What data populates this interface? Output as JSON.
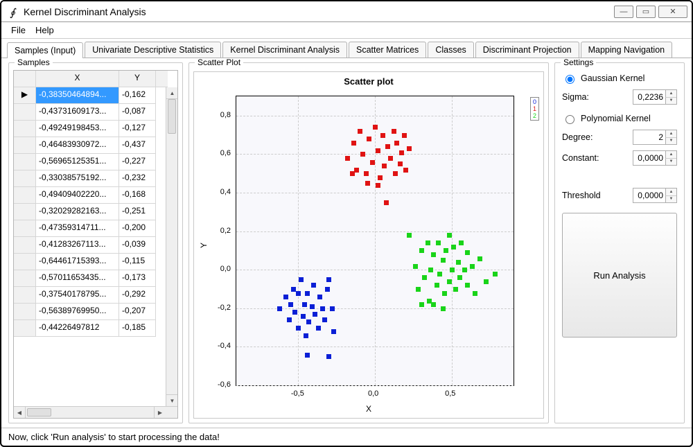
{
  "window": {
    "title": "Kernel Discriminant Analysis"
  },
  "menu": {
    "file": "File",
    "help": "Help"
  },
  "tabs": [
    "Samples (Input)",
    "Univariate Descriptive Statistics",
    "Kernel Discriminant Analysis",
    "Scatter Matrices",
    "Classes",
    "Discriminant Projection",
    "Mapping Navigation"
  ],
  "groups": {
    "samples": "Samples",
    "scatter": "Scatter Plot",
    "settings": "Settings"
  },
  "datagrid": {
    "columns": {
      "x": "X",
      "y": "Y"
    },
    "selector_glyph": "▶",
    "rows": [
      {
        "x": "-0,38350464894...",
        "y": "-0,162"
      },
      {
        "x": "-0,43731609173...",
        "y": "-0,087"
      },
      {
        "x": "-0,49249198453...",
        "y": "-0,127"
      },
      {
        "x": "-0,46483930972...",
        "y": "-0,437"
      },
      {
        "x": "-0,56965125351...",
        "y": "-0,227"
      },
      {
        "x": "-0,33038575192...",
        "y": "-0,232"
      },
      {
        "x": "-0,49409402220...",
        "y": "-0,168"
      },
      {
        "x": "-0,32029282163...",
        "y": "-0,251"
      },
      {
        "x": "-0,47359314711...",
        "y": "-0,200"
      },
      {
        "x": "-0,41283267113...",
        "y": "-0,039"
      },
      {
        "x": "-0,64461715393...",
        "y": "-0,115"
      },
      {
        "x": "-0,57011653435...",
        "y": "-0,173"
      },
      {
        "x": "-0,37540178795...",
        "y": "-0,292"
      },
      {
        "x": "-0,56389769950...",
        "y": "-0,207"
      },
      {
        "x": "-0,44226497812",
        "y": "-0,185"
      }
    ]
  },
  "chart_data": {
    "type": "scatter",
    "title": "Scatter plot",
    "xlabel": "X",
    "ylabel": "Y",
    "xlim": [
      -0.9,
      0.9
    ],
    "ylim": [
      -0.6,
      0.9
    ],
    "xticks": [
      -0.5,
      0.0,
      0.5
    ],
    "yticks": [
      -0.6,
      -0.4,
      -0.2,
      0.0,
      0.2,
      0.4,
      0.6,
      0.8
    ],
    "legend": [
      "0",
      "1",
      "2"
    ],
    "series": [
      {
        "name": "0",
        "color": "#0b1fd6",
        "points": [
          [
            -0.62,
            -0.2
          ],
          [
            -0.58,
            -0.14
          ],
          [
            -0.56,
            -0.26
          ],
          [
            -0.55,
            -0.18
          ],
          [
            -0.53,
            -0.1
          ],
          [
            -0.52,
            -0.22
          ],
          [
            -0.5,
            -0.3
          ],
          [
            -0.5,
            -0.12
          ],
          [
            -0.48,
            -0.05
          ],
          [
            -0.47,
            -0.24
          ],
          [
            -0.46,
            -0.18
          ],
          [
            -0.45,
            -0.34
          ],
          [
            -0.44,
            -0.12
          ],
          [
            -0.43,
            -0.27
          ],
          [
            -0.41,
            -0.19
          ],
          [
            -0.4,
            -0.08
          ],
          [
            -0.39,
            -0.23
          ],
          [
            -0.37,
            -0.3
          ],
          [
            -0.36,
            -0.14
          ],
          [
            -0.34,
            -0.2
          ],
          [
            -0.33,
            -0.26
          ],
          [
            -0.31,
            -0.1
          ],
          [
            -0.3,
            -0.45
          ],
          [
            -0.28,
            -0.2
          ],
          [
            -0.27,
            -0.32
          ],
          [
            -0.44,
            -0.44
          ],
          [
            -0.3,
            -0.05
          ]
        ]
      },
      {
        "name": "1",
        "color": "#e01313",
        "points": [
          [
            -0.18,
            0.58
          ],
          [
            -0.14,
            0.66
          ],
          [
            -0.12,
            0.52
          ],
          [
            -0.1,
            0.72
          ],
          [
            -0.08,
            0.6
          ],
          [
            -0.06,
            0.5
          ],
          [
            -0.04,
            0.68
          ],
          [
            -0.02,
            0.56
          ],
          [
            0.0,
            0.74
          ],
          [
            0.02,
            0.62
          ],
          [
            0.03,
            0.48
          ],
          [
            0.05,
            0.7
          ],
          [
            0.06,
            0.54
          ],
          [
            0.08,
            0.64
          ],
          [
            0.07,
            0.35
          ],
          [
            0.1,
            0.58
          ],
          [
            0.12,
            0.72
          ],
          [
            0.13,
            0.5
          ],
          [
            0.14,
            0.66
          ],
          [
            0.16,
            0.55
          ],
          [
            0.17,
            0.61
          ],
          [
            0.19,
            0.7
          ],
          [
            0.2,
            0.52
          ],
          [
            0.22,
            0.63
          ],
          [
            0.02,
            0.44
          ],
          [
            -0.05,
            0.45
          ],
          [
            -0.15,
            0.5
          ]
        ]
      },
      {
        "name": "2",
        "color": "#19d419",
        "points": [
          [
            0.22,
            0.18
          ],
          [
            0.26,
            0.02
          ],
          [
            0.28,
            -0.1
          ],
          [
            0.3,
            0.1
          ],
          [
            0.32,
            -0.04
          ],
          [
            0.34,
            0.14
          ],
          [
            0.35,
            -0.16
          ],
          [
            0.36,
            0.0
          ],
          [
            0.38,
            0.08
          ],
          [
            0.4,
            -0.08
          ],
          [
            0.41,
            0.14
          ],
          [
            0.42,
            -0.02
          ],
          [
            0.44,
            0.05
          ],
          [
            0.45,
            -0.12
          ],
          [
            0.46,
            0.1
          ],
          [
            0.48,
            -0.06
          ],
          [
            0.5,
            0.0
          ],
          [
            0.51,
            0.12
          ],
          [
            0.52,
            -0.1
          ],
          [
            0.54,
            0.04
          ],
          [
            0.55,
            -0.04
          ],
          [
            0.56,
            0.14
          ],
          [
            0.58,
            0.0
          ],
          [
            0.6,
            -0.08
          ],
          [
            0.6,
            0.09
          ],
          [
            0.63,
            0.02
          ],
          [
            0.65,
            -0.12
          ],
          [
            0.68,
            0.06
          ],
          [
            0.72,
            -0.06
          ],
          [
            0.78,
            -0.02
          ],
          [
            0.38,
            -0.18
          ],
          [
            0.3,
            -0.18
          ],
          [
            0.48,
            0.18
          ],
          [
            0.44,
            -0.2
          ]
        ]
      }
    ]
  },
  "settings": {
    "gaussian_label": "Gaussian Kernel",
    "sigma_label": "Sigma:",
    "sigma_value": "0,2236",
    "poly_label": "Polynomial Kernel",
    "degree_label": "Degree:",
    "degree_value": "2",
    "constant_label": "Constant:",
    "constant_value": "0,0000",
    "threshold_label": "Threshold",
    "threshold_value": "0,0000",
    "run_label": "Run Analysis"
  },
  "status": {
    "text": "Now, click 'Run analysis' to start processing the data!"
  }
}
